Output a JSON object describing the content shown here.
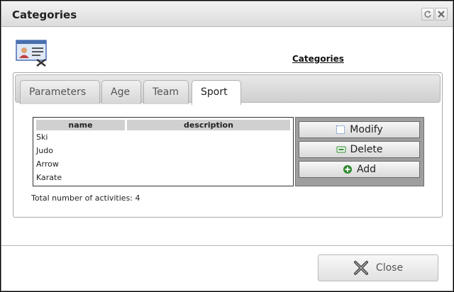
{
  "window": {
    "title": "Categories"
  },
  "header": {
    "link": "Categories",
    "icon": "user-list-icon"
  },
  "tabs": [
    {
      "label": "Parameters"
    },
    {
      "label": "Age"
    },
    {
      "label": "Team"
    },
    {
      "label": "Sport",
      "active": true
    }
  ],
  "table": {
    "columns": [
      "name",
      "description"
    ],
    "rows": [
      {
        "name": "Ski",
        "description": ""
      },
      {
        "name": "Judo",
        "description": ""
      },
      {
        "name": "Arrow",
        "description": ""
      },
      {
        "name": "Karate",
        "description": ""
      }
    ]
  },
  "actions": {
    "modify": "Modify",
    "delete": "Delete",
    "add": "Add"
  },
  "total_text": "Total number of activities: 4",
  "footer": {
    "close": "Close"
  },
  "colors": {
    "add_green": "#2e8b2e",
    "delete_green": "#3a8f3a",
    "modify_blue": "#6f93c9"
  }
}
